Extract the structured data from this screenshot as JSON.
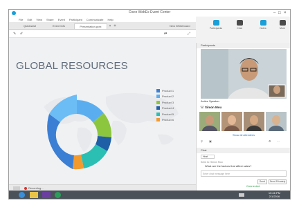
{
  "window": {
    "title": "Cisco WebEx Event Center",
    "controls": [
      "–",
      "□",
      "×"
    ]
  },
  "menu": [
    "File",
    "Edit",
    "View",
    "Share",
    "Event",
    "Participant",
    "Communicate",
    "Help"
  ],
  "tabs": {
    "quickstart": "Quickstart",
    "eventinfo": "Event Info",
    "presentation": "Presentation.pptx",
    "new_whiteboard": "New Whiteboard"
  },
  "nav": [
    {
      "label": "Participants",
      "icon": "participants-icon",
      "color": "#1a9fd8"
    },
    {
      "label": "Chat",
      "icon": "chat-icon",
      "color": "#4b4b4b"
    },
    {
      "label": "Notes",
      "icon": "notes-icon",
      "color": "#1a9fd8"
    },
    {
      "label": "More",
      "icon": "more-icon",
      "color": "#4b4b4b"
    }
  ],
  "slide": {
    "title": "GLOBAL RESOURCES",
    "legend": [
      {
        "label": "Product 1",
        "color": "#3b7fd4"
      },
      {
        "label": "Product 2",
        "color": "#5aaef0"
      },
      {
        "label": "Product 3",
        "color": "#8cc63f"
      },
      {
        "label": "Product 4",
        "color": "#1f5fa6"
      },
      {
        "label": "Product 5",
        "color": "#2bbfb3"
      },
      {
        "label": "Product 6",
        "color": "#f39a2e"
      }
    ]
  },
  "status": {
    "recording": "Recording..."
  },
  "participants": {
    "header": "Participants",
    "active_speaker": "Active Speaker",
    "speaker_name": "Simon Mou",
    "show_all": "Show all attendees"
  },
  "chat": {
    "header": "Chat",
    "to": "Host",
    "meta": "Send to: Simon Mou",
    "message": "What are the factors that affect sales?",
    "input_placeholder": "Enter chat message here",
    "send": "Send",
    "send_privately": "Send Privately"
  },
  "taskbar": {
    "connected": "Connected",
    "time": "10:46 PM",
    "date": "2/1/2016"
  }
}
